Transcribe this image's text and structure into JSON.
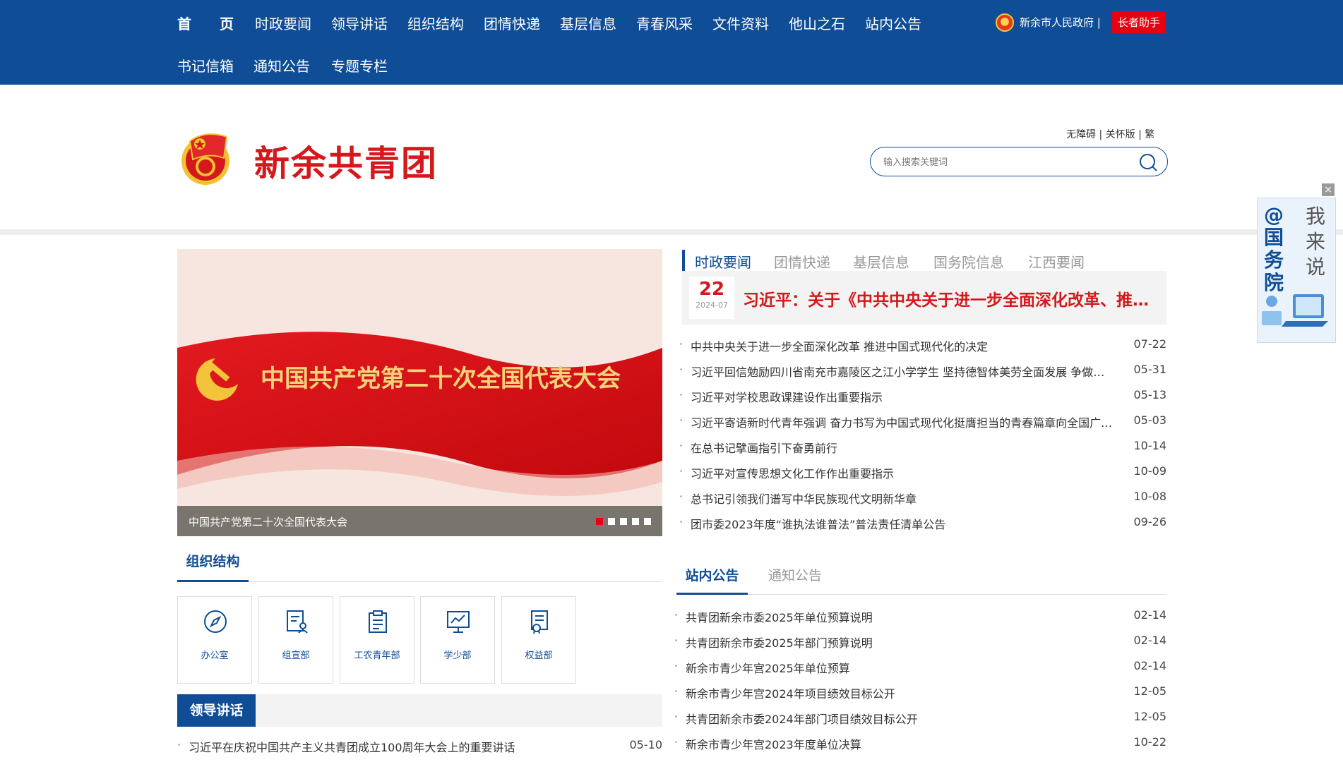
{
  "nav": {
    "row1": [
      "首　　页",
      "时政要闻",
      "领导讲话",
      "组织结构",
      "团情快递",
      "基层信息",
      "青春风采",
      "文件资料",
      "他山之石",
      "站内公告"
    ],
    "row2": [
      "书记信箱",
      "通知公告",
      "专题专栏"
    ],
    "gov_link": "新余市人民政府 |",
    "elder_button": "长者助手"
  },
  "header": {
    "site_title": "新余共青团",
    "accessibility_links": "无障碍 | 关怀版 | 繁",
    "search_placeholder": "输入搜索关键词"
  },
  "carousel": {
    "banner_text": "中国共产党第二十次全国代表大会",
    "caption": "中国共产党第二十次全国代表大会",
    "dots": 5,
    "active_dot": 0
  },
  "news": {
    "tabs": [
      "时政要闻",
      "团情快递",
      "基层信息",
      "国务院信息",
      "江西要闻"
    ],
    "active_tab": 0,
    "headline": {
      "day": "22",
      "year_month": "2024-07",
      "title": "习近平：关于《中共中央关于进一步全面深化改革、推进中国式现代化的决定》的说明"
    },
    "items": [
      {
        "title": "中共中央关于进一步全面深化改革 推进中国式现代化的决定",
        "date": "07-22"
      },
      {
        "title": "习近平回信勉励四川省南充市嘉陵区之江小学学生 坚持德智体美劳全面发展 争做爱国爱党好少年",
        "date": "05-31"
      },
      {
        "title": "习近平对学校思政课建设作出重要指示",
        "date": "05-13"
      },
      {
        "title": "习近平寄语新时代青年强调 奋力书写为中国式现代化挺膺担当的青春篇章向全国广大青年致以节日祝贺",
        "date": "05-03"
      },
      {
        "title": "在总书记擘画指引下奋勇前行",
        "date": "10-14"
      },
      {
        "title": "习近平对宣传思想文化工作作出重要指示",
        "date": "10-09"
      },
      {
        "title": "总书记引领我们谱写中华民族现代文明新华章",
        "date": "10-08"
      },
      {
        "title": "团市委2023年度“谁执法谁普法”普法责任清单公告",
        "date": "09-26"
      }
    ]
  },
  "org": {
    "title": "组织结构",
    "cards": [
      {
        "label": "办公室",
        "icon": "compass-icon"
      },
      {
        "label": "组宣部",
        "icon": "document-person-icon"
      },
      {
        "label": "工农青年部",
        "icon": "clipboard-icon"
      },
      {
        "label": "学少部",
        "icon": "monitor-chart-icon"
      },
      {
        "label": "权益部",
        "icon": "certificate-icon"
      }
    ]
  },
  "leader": {
    "title": "领导讲话",
    "items": [
      {
        "title": "习近平在庆祝中国共产主义共青团成立100周年大会上的重要讲话",
        "date": "05-10"
      }
    ]
  },
  "notice": {
    "tabs": [
      "站内公告",
      "通知公告"
    ],
    "active_tab": 0,
    "items": [
      {
        "title": "共青团新余市委2025年单位预算说明",
        "date": "02-14"
      },
      {
        "title": "共青团新余市委2025年部门预算说明",
        "date": "02-14"
      },
      {
        "title": "新余市青少年宫2025年单位预算",
        "date": "02-14"
      },
      {
        "title": "新余市青少年宫2024年项目绩效目标公开",
        "date": "12-05"
      },
      {
        "title": "共青团新余市委2024年部门项目绩效目标公开",
        "date": "12-05"
      },
      {
        "title": "新余市青少年宫2023年度单位决算",
        "date": "10-22"
      }
    ]
  },
  "side_float": {
    "left_text": "@国务院",
    "right_text": "我来说",
    "close": "×"
  },
  "colors": {
    "brand_blue": "#0f4d96",
    "brand_red": "#d4181b",
    "accent_red": "#e60012"
  }
}
